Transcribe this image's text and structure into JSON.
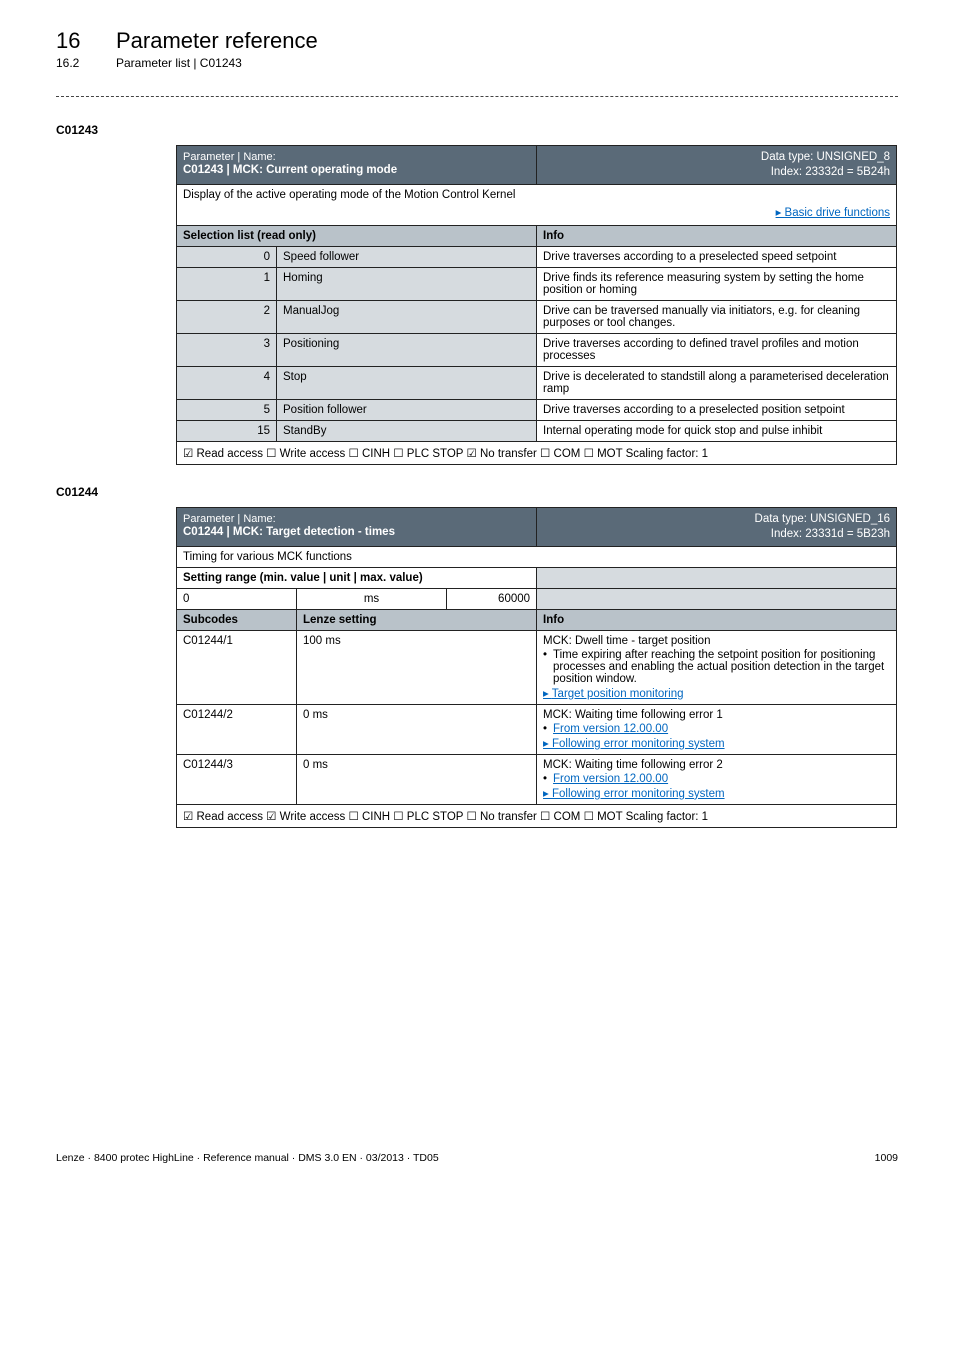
{
  "header": {
    "chapter_num": "16",
    "chapter_title": "Parameter reference",
    "section_num": "16.2",
    "section_title": "Parameter list | C01243"
  },
  "c01243": {
    "code": "C01243",
    "title_left_top": "Parameter | Name:",
    "title_left_main": "C01243 | MCK: Current operating mode",
    "title_right_top": "Data type: UNSIGNED_8",
    "title_right_bottom": "Index: 23332d = 5B24h",
    "display_text": "Display of the active operating mode of the Motion Control Kernel",
    "basic_link": "Basic drive functions",
    "sel_list_label": "Selection list (read only)",
    "info_label": "Info",
    "rows": [
      {
        "val": "0",
        "name": "Speed follower",
        "info": "Drive traverses according to a preselected speed setpoint"
      },
      {
        "val": "1",
        "name": "Homing",
        "info": "Drive finds its reference measuring system by setting the home position or homing"
      },
      {
        "val": "2",
        "name": "ManualJog",
        "info": "Drive can be traversed manually via initiators, e.g. for cleaning purposes or tool changes."
      },
      {
        "val": "3",
        "name": "Positioning",
        "info": "Drive traverses according to defined travel profiles and motion processes"
      },
      {
        "val": "4",
        "name": "Stop",
        "info": "Drive is decelerated to standstill along a parameterised deceleration ramp"
      },
      {
        "val": "5",
        "name": "Position follower",
        "info": "Drive traverses according to a preselected position setpoint"
      },
      {
        "val": "15",
        "name": "StandBy",
        "info": "Internal operating mode for quick stop and pulse inhibit"
      }
    ],
    "foot": "☑ Read access   ☐ Write access   ☐ CINH   ☐ PLC STOP   ☑ No transfer   ☐ COM   ☐ MOT    Scaling factor: 1"
  },
  "c01244": {
    "code": "C01244",
    "title_left_top": "Parameter | Name:",
    "title_left_main": "C01244 | MCK: Target detection - times",
    "title_right_top": "Data type: UNSIGNED_16",
    "title_right_bottom": "Index: 23331d = 5B23h",
    "timing_text": "Timing for various MCK functions",
    "setting_range_label": "Setting range (min. value | unit | max. value)",
    "range_min": "0",
    "range_unit": "ms",
    "range_max": "60000",
    "subcodes_label": "Subcodes",
    "lenze_label": "Lenze setting",
    "info_label": "Info",
    "rows": [
      {
        "sub": "C01244/1",
        "lenze": "100 ms",
        "info_line1": "MCK: Dwell time - target position",
        "bullet": "Time expiring after reaching the setpoint position for positioning processes and enabling the actual position detection in the target position window.",
        "link": "Target position monitoring"
      },
      {
        "sub": "C01244/2",
        "lenze": "0 ms",
        "info_line1": "MCK: Waiting time following error 1",
        "bullet_link1": "From version 12.00.00",
        "link": "Following error monitoring system"
      },
      {
        "sub": "C01244/3",
        "lenze": "0 ms",
        "info_line1": "MCK: Waiting time following error 2",
        "bullet_link1": "From version 12.00.00",
        "link": "Following error monitoring system"
      }
    ],
    "foot": "☑ Read access   ☑ Write access   ☐ CINH   ☐ PLC STOP   ☐ No transfer   ☐ COM   ☐ MOT    Scaling factor: 1"
  },
  "footer": {
    "left": "Lenze · 8400 protec HighLine · Reference manual · DMS 3.0 EN · 03/2013 · TD05",
    "right": "1009"
  }
}
